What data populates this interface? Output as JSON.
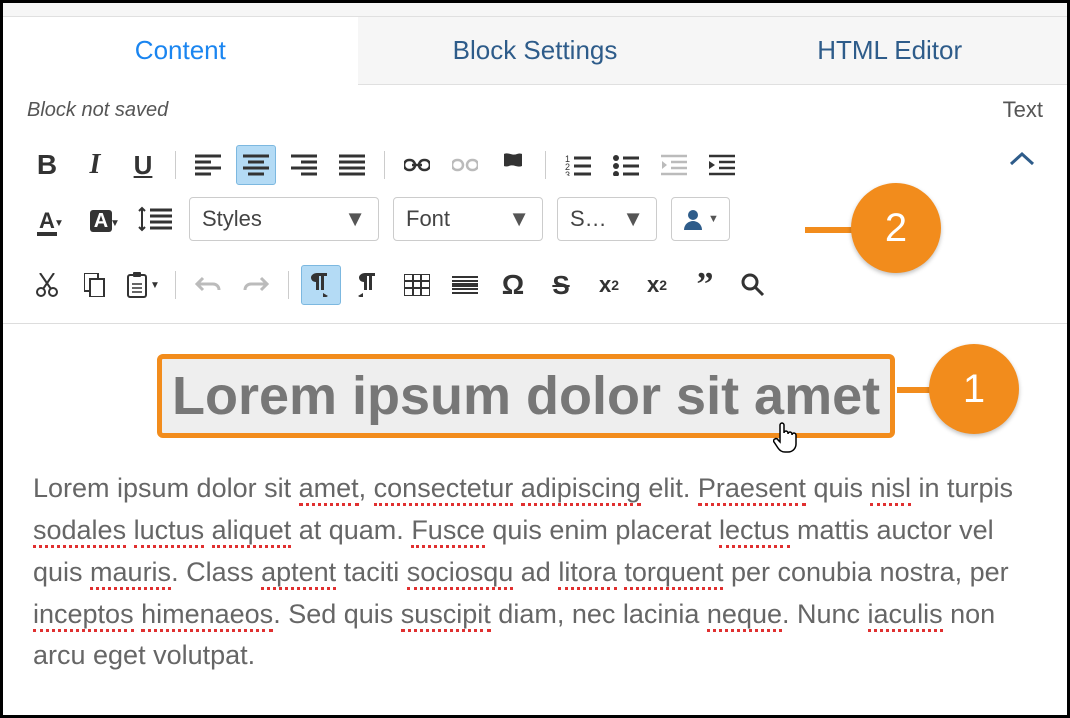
{
  "tabs": {
    "content": "Content",
    "block_settings": "Block Settings",
    "html_editor": "HTML Editor"
  },
  "status": {
    "not_saved": "Block not saved",
    "context": "Text"
  },
  "dropdowns": {
    "styles": "Styles",
    "font": "Font",
    "size": "S…"
  },
  "callouts": {
    "one": "1",
    "two": "2"
  },
  "editor": {
    "heading": "Lorem ipsum dolor sit amet",
    "paragraph_parts": {
      "p1": "Lorem ipsum dolor sit ",
      "w1": "amet",
      "p2": ", ",
      "w2": "consectetur",
      "p3": " ",
      "w3": "adipiscing",
      "p4": " elit. ",
      "w4": "Praesent",
      "p5": " quis ",
      "w5": "nisl",
      "p6": " in turpis ",
      "w6": "sodales",
      "p7": " ",
      "w7": "luctus",
      "p8": " ",
      "w8": "aliquet",
      "p9": " at quam. ",
      "w9": "Fusce",
      "p10": " quis enim placerat ",
      "w10": "lectus",
      "p11": " mattis auctor vel quis ",
      "w11": "mauris",
      "p12": ". Class ",
      "w12": "aptent",
      "p13": " taciti ",
      "w13": "sociosqu",
      "p14": " ad ",
      "w14": "litora",
      "p15": " ",
      "w15": "torquent",
      "p16": " per conubia nostra, per ",
      "w16": "inceptos",
      "p17": " ",
      "w17": "himenaeos",
      "p18": ". Sed quis ",
      "w18": "suscipit",
      "p19": " diam, nec lacinia ",
      "w19": "neque",
      "p20": ". Nunc ",
      "w20": "iaculis",
      "p21": " non arcu eget volutpat."
    }
  }
}
